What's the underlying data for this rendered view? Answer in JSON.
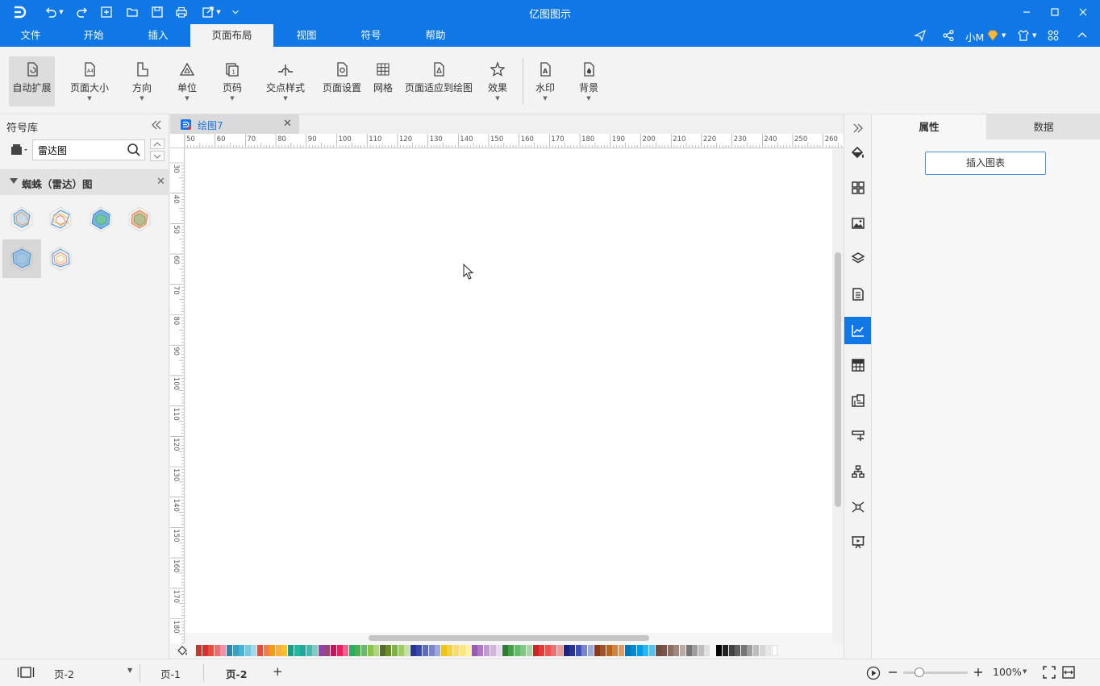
{
  "app": {
    "title": "亿图图示"
  },
  "menu": {
    "tabs": [
      {
        "label": "文件"
      },
      {
        "label": "开始"
      },
      {
        "label": "插入"
      },
      {
        "label": "页面布局"
      },
      {
        "label": "视图"
      },
      {
        "label": "符号"
      },
      {
        "label": "帮助"
      }
    ],
    "active_tab": "页面布局",
    "user": "小M"
  },
  "ribbon": {
    "auto_expand": "自动扩展",
    "page_size": "页面大小",
    "orientation": "方向",
    "unit": "单位",
    "page_number": "页码",
    "cross_style": "交点样式",
    "page_setup": "页面设置",
    "grid": "网格",
    "fit_to_drawing": "页面适应到绘图",
    "effects": "效果",
    "watermark": "水印",
    "background": "背景"
  },
  "library": {
    "title": "符号库",
    "search_value": "雷达图",
    "category": "蜘蛛（雷达）图"
  },
  "document": {
    "tab_name": "绘图7"
  },
  "ruler": {
    "h_ticks": [
      "50",
      "60",
      "70",
      "80",
      "90",
      "100",
      "110",
      "120",
      "130",
      "140",
      "150",
      "160",
      "170",
      "180",
      "190",
      "200",
      "210",
      "220",
      "230",
      "240",
      "250",
      "260"
    ],
    "v_ticks": [
      "30",
      "40",
      "50",
      "60",
      "70",
      "80",
      "90",
      "100",
      "110",
      "120",
      "130",
      "140",
      "150",
      "160",
      "170",
      "180"
    ]
  },
  "right_panel": {
    "tab_properties": "属性",
    "tab_data": "数据",
    "insert_chart": "插入图表"
  },
  "status": {
    "page_select": "页-2",
    "page1": "页-1",
    "page2": "页-2",
    "add_page": "+",
    "zoom": "100%"
  },
  "colors": {
    "accent": "#0f78e6",
    "palette": [
      "#c0392b",
      "#d63031",
      "#e74c3c",
      "#e57373",
      "#f48fb1",
      "#2e86ab",
      "#3aa0c8",
      "#45b5d6",
      "#76c7e0",
      "#a3d9ea",
      "#e74c3c",
      "#f08050",
      "#f39c12",
      "#f5b041",
      "#fbc02d",
      "#16a085",
      "#1abc9c",
      "#26a69a",
      "#4db6ac",
      "#80cbc4",
      "#8e44ad",
      "#a0427a",
      "#c2185b",
      "#e91e63",
      "#f06292",
      "#27ae60",
      "#4caf50",
      "#66bb6a",
      "#8bc34a",
      "#aed581",
      "#556b2f",
      "#6b8e23",
      "#7cb342",
      "#9ccc65",
      "#c5e1a5",
      "#283593",
      "#3949ab",
      "#5c6bc0",
      "#7986cb",
      "#9fa8da",
      "#f1c40f",
      "#f4d03f",
      "#f7dc6f",
      "#fae57a",
      "#fdf2a6",
      "#9b59b6",
      "#af7ac5",
      "#c39bd3",
      "#d2b4de",
      "#e8daef",
      "#2e7d32",
      "#43a047",
      "#66bb6a",
      "#81c784",
      "#a5d6a7",
      "#c62828",
      "#e53935",
      "#ef5350",
      "#e57373",
      "#ef9a9a",
      "#1a237e",
      "#283593",
      "#3f51b5",
      "#7986cb",
      "#9fa8da",
      "#8d3a1a",
      "#a0522d",
      "#b5651d",
      "#cd853f",
      "#e39a63",
      "#0277bd",
      "#0288d1",
      "#039be5",
      "#29b6f6",
      "#4fc3f7",
      "#6d4c41",
      "#795548",
      "#8d6e63",
      "#a1887f",
      "#bcaaa4",
      "#757575",
      "#9e9e9e",
      "#bdbdbd",
      "#e0e0e0",
      "#f5f5f5",
      "#000000",
      "#212121",
      "#424242",
      "#616161",
      "#757575",
      "#9e9e9e",
      "#bdbdbd",
      "#d6d6d6",
      "#e6e6e6",
      "#ffffff"
    ]
  }
}
